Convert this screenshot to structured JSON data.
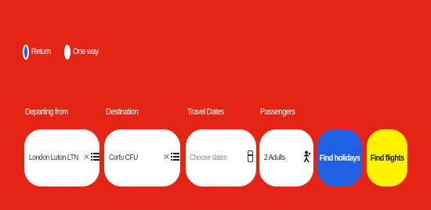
{
  "theme": {
    "background": "#e42516",
    "holidays_button": "#1f5fe0",
    "flights_button": "#fff200"
  },
  "trip_type": {
    "options": [
      {
        "label": "Return",
        "selected": true
      },
      {
        "label": "One way",
        "selected": false
      }
    ]
  },
  "search": {
    "departing": {
      "label": "Departing from",
      "value": "London Luton LTN",
      "clear_icon": "close-icon",
      "list_icon": "list-icon"
    },
    "destination": {
      "label": "Destination",
      "value": "Corfu CFU",
      "clear_icon": "close-icon",
      "list_icon": "list-icon"
    },
    "dates": {
      "label": "Travel Dates",
      "placeholder": "Choose dates",
      "icon": "calendar-icon"
    },
    "passengers": {
      "label": "Passengers",
      "value": "2 Adults",
      "icon": "person-icon"
    }
  },
  "buttons": {
    "find_holidays": "Find holidays",
    "find_flights": "Find flights"
  }
}
